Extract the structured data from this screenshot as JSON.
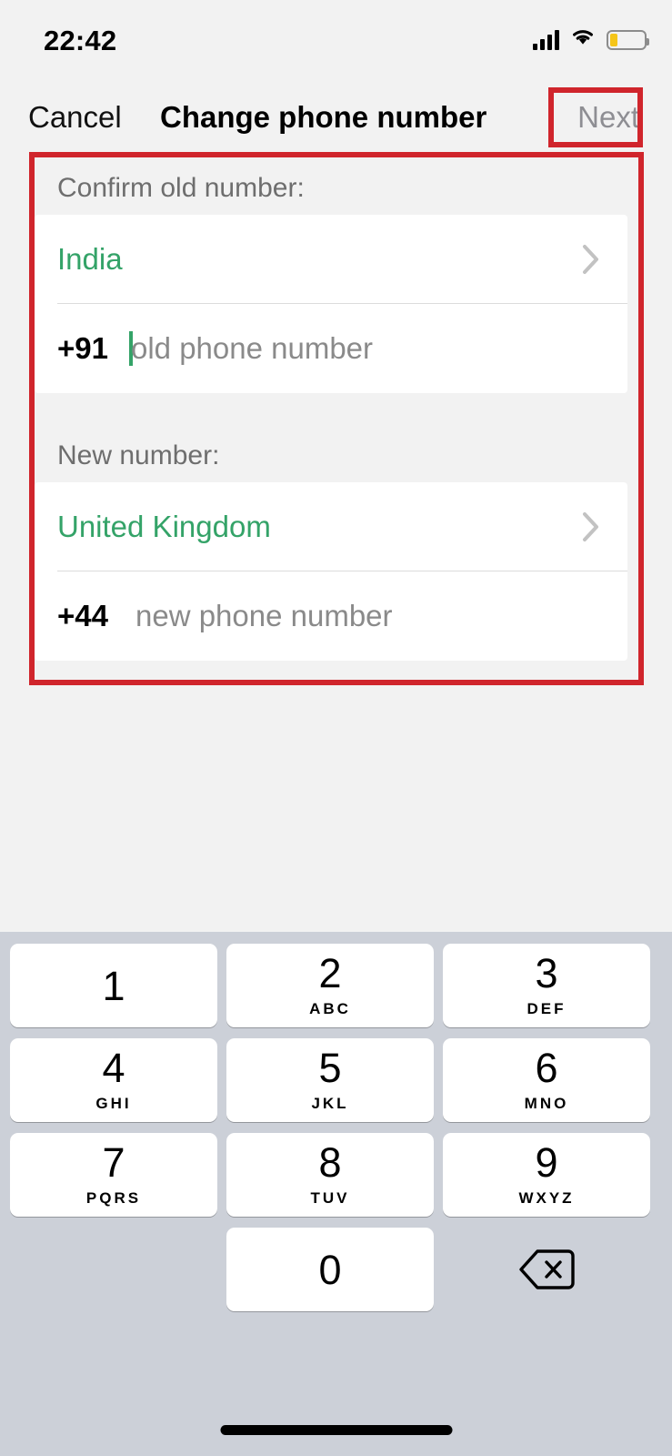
{
  "status_bar": {
    "time": "22:42",
    "signal_icon": "cellular-signal-icon",
    "wifi_icon": "wifi-icon",
    "battery_icon": "battery-low-icon",
    "battery_level_percent": 18,
    "battery_fill_color": "#f5c518"
  },
  "nav": {
    "cancel_label": "Cancel",
    "title": "Change phone number",
    "next_label": "Next",
    "next_enabled": false,
    "next_color": "#8e8e93"
  },
  "annotations": {
    "color": "#d0252c",
    "boxes": [
      {
        "name": "next-button-highlight"
      },
      {
        "name": "form-highlight"
      }
    ]
  },
  "form": {
    "old_section": {
      "header": "Confirm old number:",
      "country": "India",
      "country_color": "#34a368",
      "chevron_icon": "chevron-right-icon",
      "dial_code": "+91",
      "phone_placeholder": "old phone number",
      "phone_value": "",
      "caret_visible": true,
      "caret_color": "#34a368"
    },
    "new_section": {
      "header": "New number:",
      "country": "United Kingdom",
      "country_color": "#34a368",
      "chevron_icon": "chevron-right-icon",
      "dial_code": "+44",
      "phone_placeholder": "new phone number",
      "phone_value": "",
      "caret_visible": false
    }
  },
  "keyboard": {
    "type": "numeric-phone-pad",
    "background": "#ccd0d8",
    "keys": [
      {
        "digit": "1",
        "letters": ""
      },
      {
        "digit": "2",
        "letters": "ABC"
      },
      {
        "digit": "3",
        "letters": "DEF"
      },
      {
        "digit": "4",
        "letters": "GHI"
      },
      {
        "digit": "5",
        "letters": "JKL"
      },
      {
        "digit": "6",
        "letters": "MNO"
      },
      {
        "digit": "7",
        "letters": "PQRS"
      },
      {
        "digit": "8",
        "letters": "TUV"
      },
      {
        "digit": "9",
        "letters": "WXYZ"
      },
      {
        "digit": "0",
        "letters": ""
      }
    ],
    "backspace_icon": "backspace-delete-icon"
  },
  "home_indicator": "home-indicator"
}
